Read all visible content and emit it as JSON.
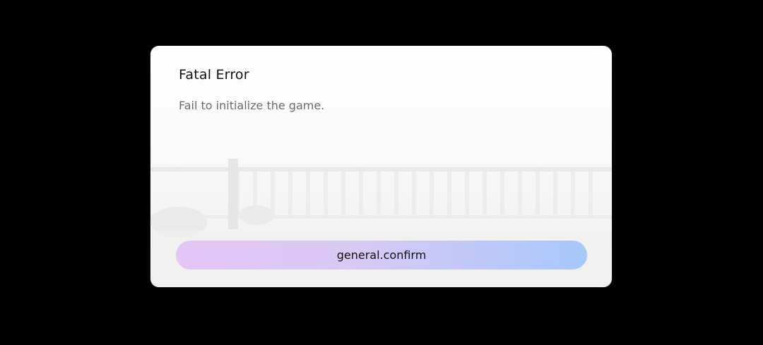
{
  "dialog": {
    "title": "Fatal Error",
    "message": "Fail to initialize the game.",
    "confirm_label": "general.confirm"
  },
  "colors": {
    "backdrop": "#000000",
    "dialog_bg": "#ffffff",
    "button_gradient_start": "#e5c6f5",
    "button_gradient_end": "#a7c7fb"
  }
}
